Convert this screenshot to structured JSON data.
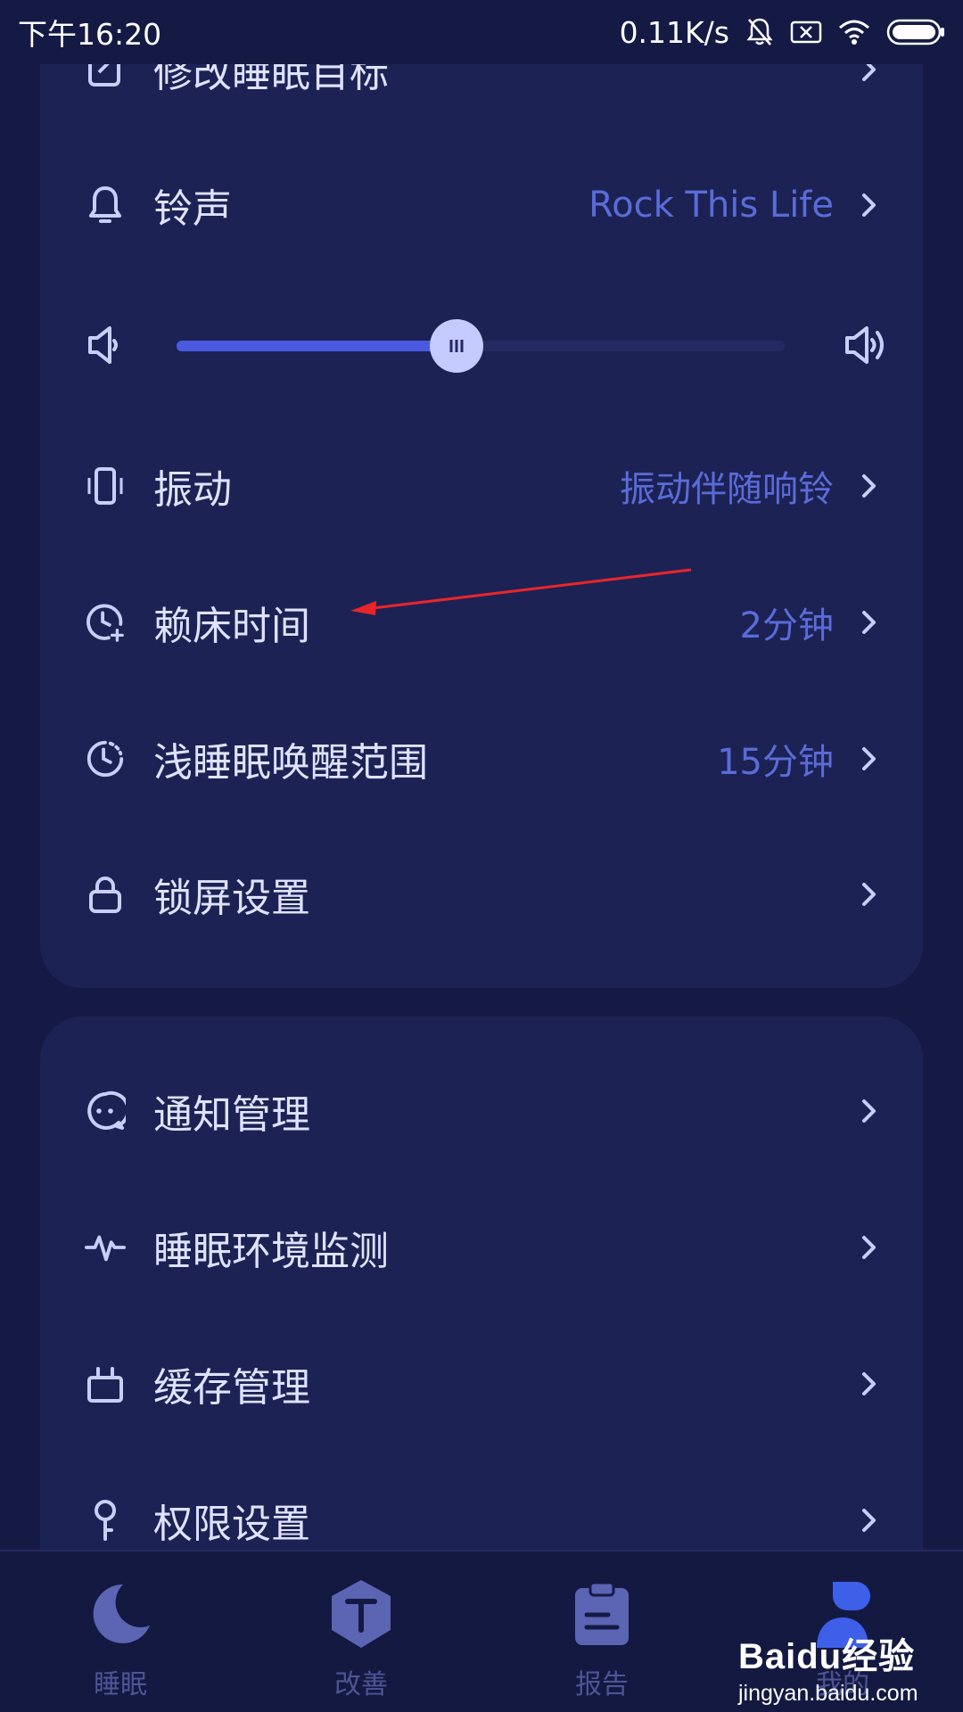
{
  "status_bar": {
    "time": "下午16:20",
    "network_speed": "0.11K/s"
  },
  "settings_group_1": {
    "partial_top_item": {
      "label": "修改睡眠目标",
      "icon": "edit-icon"
    },
    "ringtone": {
      "label": "铃声",
      "value": "Rock This Life",
      "icon": "bell-icon"
    },
    "volume": {
      "level_fraction": 0.46
    },
    "vibration": {
      "label": "振动",
      "value": "振动伴随响铃",
      "icon": "vibrate-icon"
    },
    "snooze": {
      "label": "赖床时间",
      "value": "2分钟",
      "icon": "clock-plus-icon"
    },
    "light_sleep_wake": {
      "label": "浅睡眠唤醒范围",
      "value": "15分钟",
      "icon": "clock-dashed-icon"
    },
    "lock_screen": {
      "label": "锁屏设置",
      "icon": "lock-icon"
    }
  },
  "settings_group_2": {
    "notifications": {
      "label": "通知管理",
      "icon": "chat-bubble-icon"
    },
    "environment": {
      "label": "睡眠环境监测",
      "icon": "pulse-icon"
    },
    "cache": {
      "label": "缓存管理",
      "icon": "tv-box-icon"
    },
    "permissions": {
      "label": "权限设置",
      "icon": "key-icon"
    }
  },
  "tab_bar": {
    "tabs": [
      {
        "label": "睡眠",
        "icon": "moon-icon"
      },
      {
        "label": "改善",
        "icon": "shield-arrow-icon"
      },
      {
        "label": "报告",
        "icon": "clipboard-icon"
      },
      {
        "label": "我的",
        "icon": "user-icon"
      }
    ]
  },
  "watermark": {
    "logo": "Baidu经验",
    "url": "jingyan.baidu.com"
  },
  "colors": {
    "background": "#151a45",
    "card": "#1d2254",
    "accent": "#4a5ae0",
    "value_text": "#5a6cd8",
    "annotation_arrow": "#e8262a"
  }
}
